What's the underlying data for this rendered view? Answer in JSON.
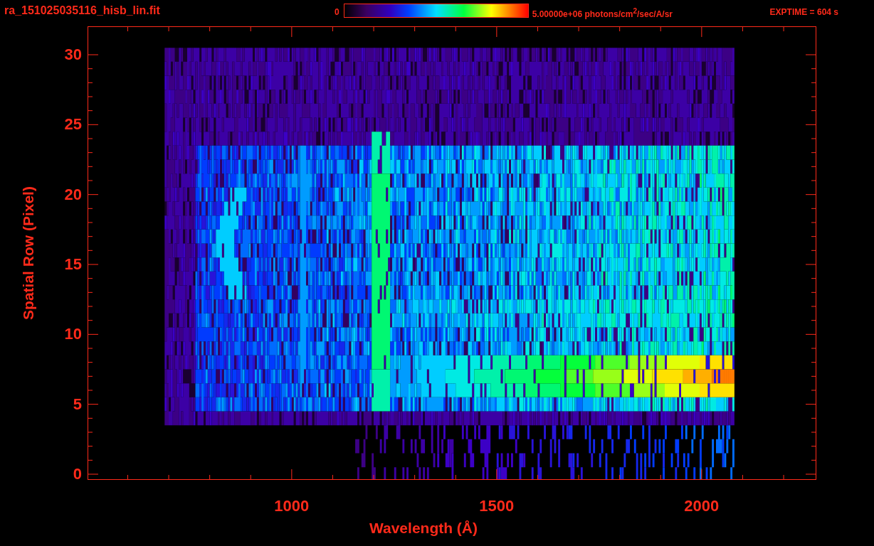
{
  "title": "ra_151025035116_hisb_lin.fit",
  "colorbar": {
    "min_label": "0",
    "max_label": "5.00000e+06 photons/cm$^{2}$/sec/A/sr"
  },
  "exposure": "EXPTIME = 604 s",
  "plot": {
    "ylabel": "Spatial Row (Pixel)",
    "xlabel": "Wavelength (Å)",
    "yticks": [
      "30",
      "25",
      "20",
      "15",
      "10",
      "5",
      "0"
    ],
    "xticks": [
      "1000",
      "1500",
      "2000"
    ]
  }
}
